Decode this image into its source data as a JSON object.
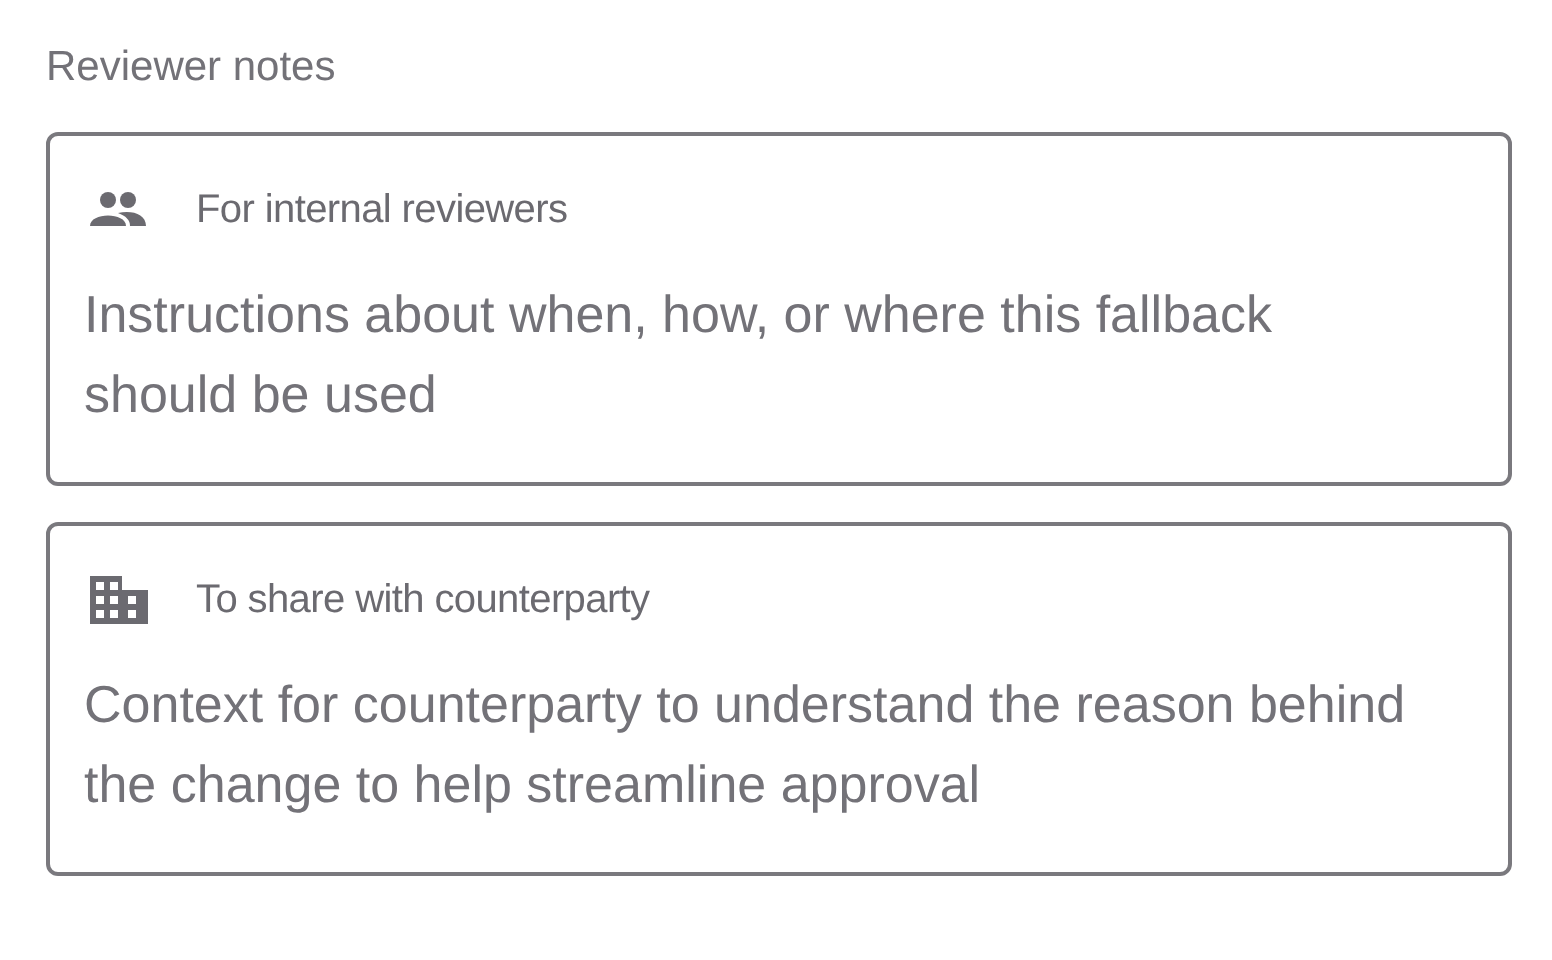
{
  "section_label": "Reviewer notes",
  "notes": [
    {
      "kind": "people",
      "label": "For internal reviewers",
      "placeholder": "Instructions about when, how, or where this fallback should be used"
    },
    {
      "kind": "building",
      "label": "To share with counterparty",
      "placeholder": "Context for counterparty to understand the reason behind the change to help streamline approval"
    }
  ]
}
